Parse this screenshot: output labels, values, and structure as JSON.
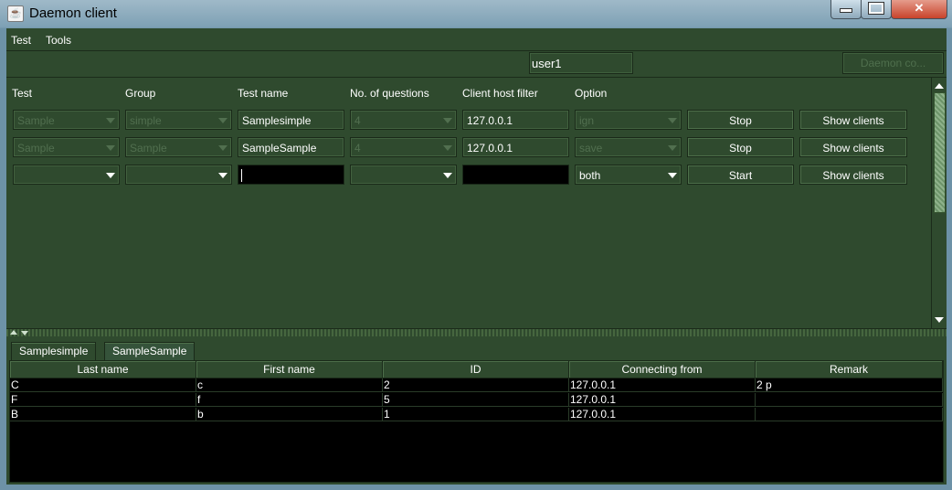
{
  "window": {
    "title": "Daemon client",
    "app_icon": "java-cup-icon",
    "controls": {
      "minimize": "minimize-icon",
      "maximize": "maximize-icon",
      "close": "✕"
    }
  },
  "menubar": {
    "items": [
      "Test",
      "Tools"
    ]
  },
  "toolbar": {
    "user_value": "user1",
    "daemon_button": "Daemon co..."
  },
  "columns": [
    "Test",
    "Group",
    "Test name",
    "No. of questions",
    "Client host filter",
    "Option"
  ],
  "rows": [
    {
      "test": "Sample",
      "group": "simple",
      "test_name": "Samplesimple",
      "questions": "4",
      "host_filter": "127.0.0.1",
      "option": "ign",
      "action": "Stop",
      "clients": "Show clients"
    },
    {
      "test": "Sample",
      "group": "Sample",
      "test_name": "SampleSample",
      "questions": "4",
      "host_filter": "127.0.0.1",
      "option": "save",
      "action": "Stop",
      "clients": "Show clients"
    },
    {
      "test": "",
      "group": "",
      "test_name": "",
      "questions": "",
      "host_filter": "",
      "option": "both",
      "action": "Start",
      "clients": "Show clients"
    }
  ],
  "tabs": [
    {
      "label": "Samplesimple",
      "active": false
    },
    {
      "label": "SampleSample",
      "active": true
    }
  ],
  "table": {
    "headers": [
      "Last name",
      "First name",
      "ID",
      "Connecting from",
      "Remark"
    ],
    "rows": [
      [
        "C",
        "c",
        "2",
        "127.0.0.1",
        "2 p"
      ],
      [
        "F",
        "f",
        "5",
        "127.0.0.1",
        ""
      ],
      [
        "B",
        "b",
        "1",
        "127.0.0.1",
        ""
      ]
    ]
  },
  "colors": {
    "panel": "#2f4a2e",
    "table_bg": "#000000",
    "text": "#ffffff",
    "disabled_text": "#516f4f"
  }
}
